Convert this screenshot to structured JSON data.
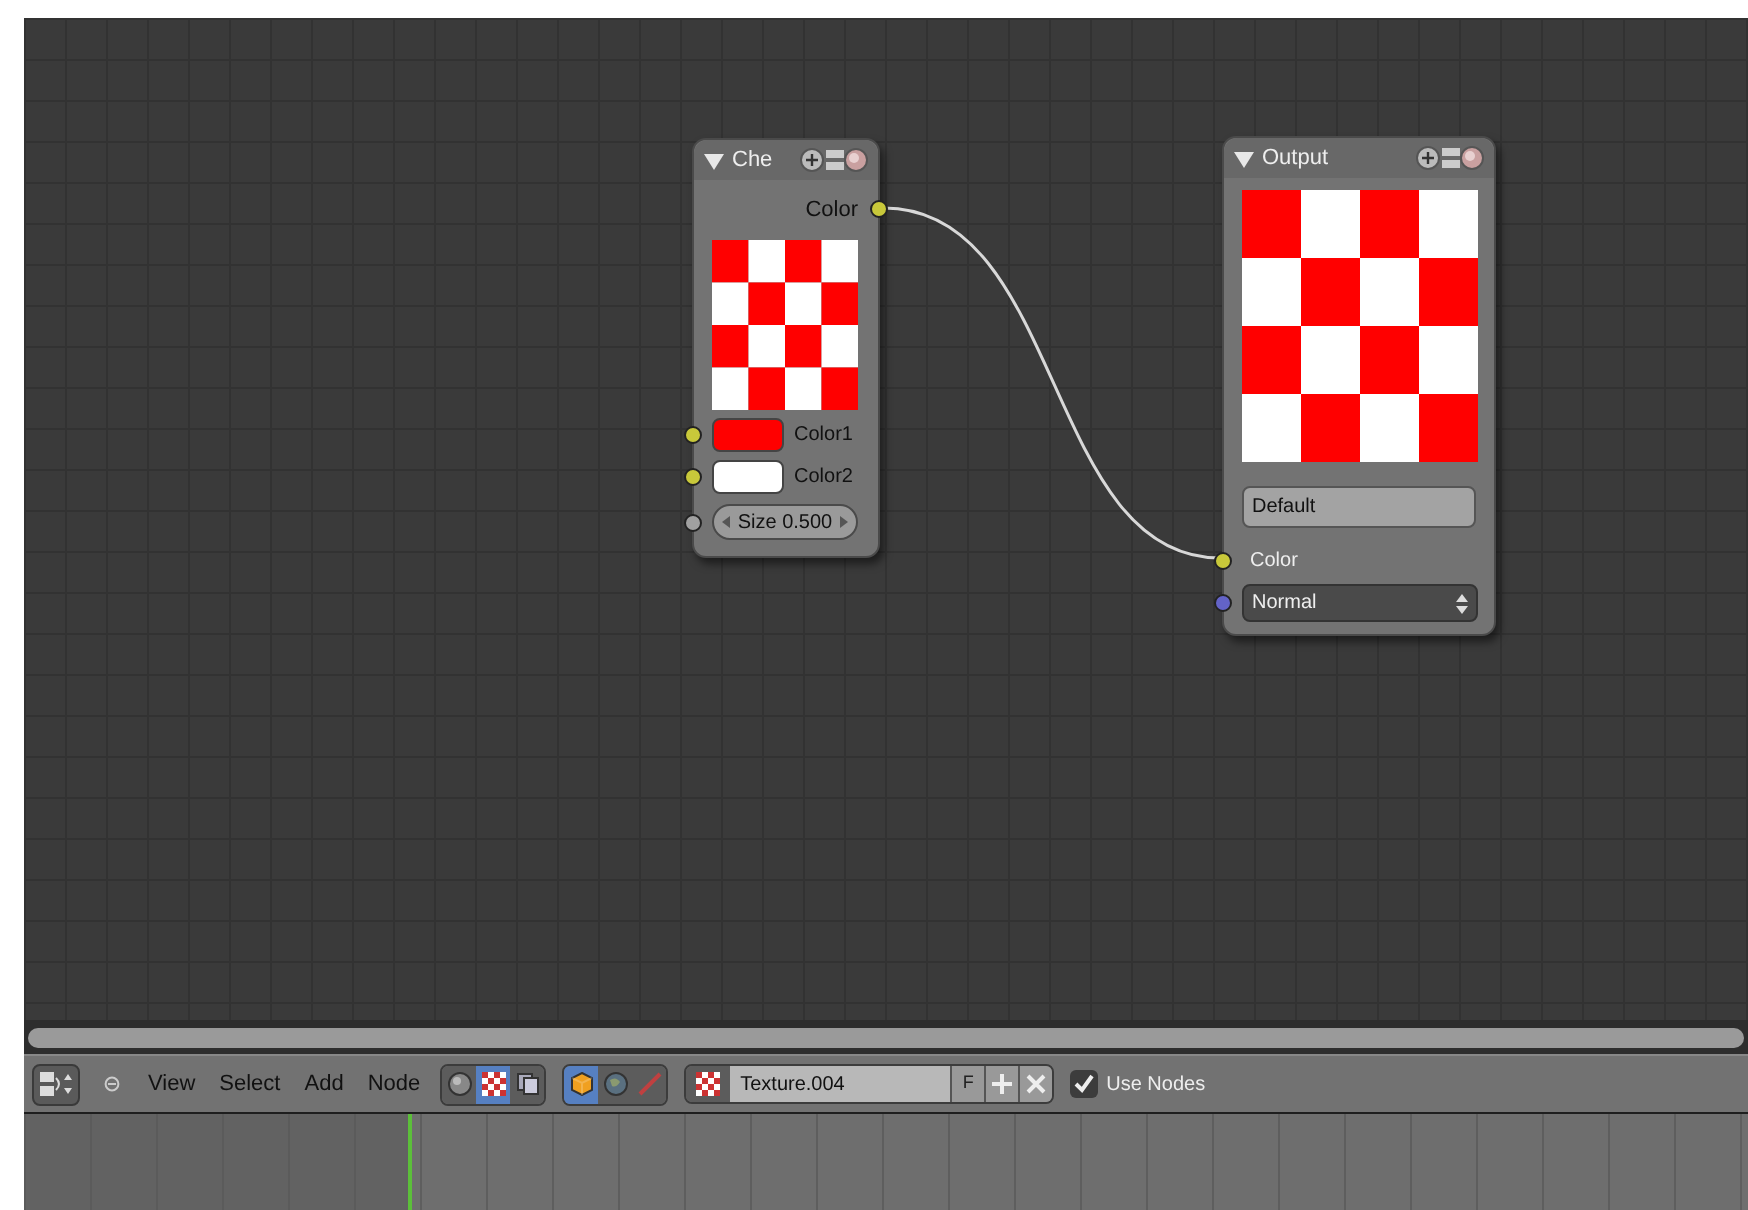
{
  "node_editor": {
    "nodes": [
      {
        "kind": "checker",
        "title": "Che",
        "collapsed": false,
        "outputs": [
          {
            "label": "Color"
          }
        ],
        "color1": {
          "label": "Color1",
          "color": "#ff0000"
        },
        "color2": {
          "label": "Color2",
          "color": "#ffffff"
        },
        "size": {
          "label": "Size 0.500"
        }
      },
      {
        "kind": "output",
        "title": "Output",
        "collapsed": false,
        "name_field": "Default",
        "inputs": [
          {
            "kind": "label",
            "label": "Color",
            "color": "#c8c83a"
          },
          {
            "kind": "dropdown",
            "label": "Normal",
            "color": "#6363c7"
          }
        ]
      }
    ]
  },
  "header": {
    "menus": [
      "View",
      "Select",
      "Add",
      "Node"
    ],
    "tree_types": [
      {
        "kind": "shader",
        "selected": false
      },
      {
        "kind": "texture",
        "selected": true
      },
      {
        "kind": "compositing",
        "selected": false
      }
    ],
    "texture_types": [
      {
        "kind": "object",
        "selected": true
      },
      {
        "kind": "world",
        "selected": false
      },
      {
        "kind": "brush",
        "selected": false
      }
    ],
    "texture_name": "Texture.004",
    "fake_user": "F",
    "use_nodes": {
      "label": "Use Nodes",
      "checked": true
    }
  }
}
